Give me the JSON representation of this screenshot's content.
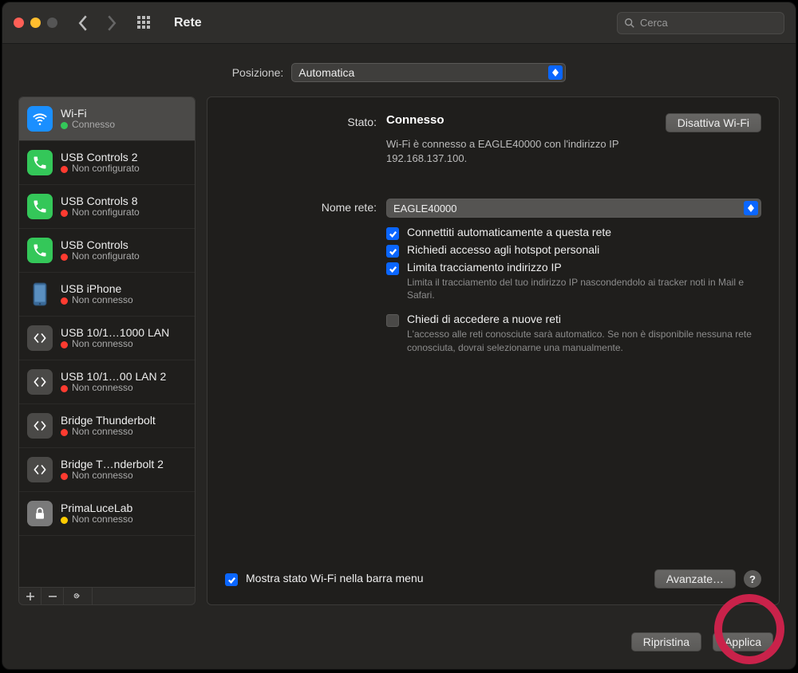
{
  "window": {
    "title": "Rete",
    "search_placeholder": "Cerca"
  },
  "location": {
    "label": "Posizione:",
    "value": "Automatica"
  },
  "services": [
    {
      "icon": "wifi",
      "name": "Wi-Fi",
      "status_label": "Connesso",
      "status": "green",
      "selected": true
    },
    {
      "icon": "phone-green",
      "name": "USB Controls 2",
      "status_label": "Non configurato",
      "status": "red"
    },
    {
      "icon": "phone-green",
      "name": "USB Controls 8",
      "status_label": "Non configurato",
      "status": "red"
    },
    {
      "icon": "phone-green",
      "name": "USB Controls",
      "status_label": "Non configurato",
      "status": "red"
    },
    {
      "icon": "iphone",
      "name": "USB iPhone",
      "status_label": "Non connesso",
      "status": "red"
    },
    {
      "icon": "eth",
      "name": "USB 10/1…1000 LAN",
      "status_label": "Non connesso",
      "status": "red"
    },
    {
      "icon": "eth",
      "name": "USB 10/1…00 LAN 2",
      "status_label": "Non connesso",
      "status": "red"
    },
    {
      "icon": "eth",
      "name": "Bridge Thunderbolt",
      "status_label": "Non connesso",
      "status": "red"
    },
    {
      "icon": "eth",
      "name": "Bridge T…nderbolt 2",
      "status_label": "Non connesso",
      "status": "red"
    },
    {
      "icon": "lock",
      "name": "PrimaLuceLab",
      "status_label": "Non connesso",
      "status": "yellow"
    }
  ],
  "main": {
    "status_label": "Stato:",
    "status_value": "Connesso",
    "disable_btn": "Disattiva Wi-Fi",
    "status_detail": "Wi-Fi è connesso a EAGLE40000 con l'indirizzo IP 192.168.137.100.",
    "network_label": "Nome rete:",
    "network_value": "EAGLE40000",
    "auto_connect": "Connettiti automaticamente a questa rete",
    "ask_hotspot": "Richiedi accesso agli hotspot personali",
    "limit_tracking": "Limita tracciamento indirizzo IP",
    "limit_tracking_desc": "Limita il tracciamento del tuo indirizzo IP nascondendolo ai tracker noti in Mail e Safari.",
    "ask_new": "Chiedi di accedere a nuove reti",
    "ask_new_desc": "L'accesso alle reti conosciute sarà automatico. Se non è disponibile nessuna rete conosciuta, dovrai selezionarne una manualmente.",
    "menubar": "Mostra stato Wi-Fi nella barra menu",
    "advanced": "Avanzate…"
  },
  "footer": {
    "revert": "Ripristina",
    "apply": "Applica"
  }
}
